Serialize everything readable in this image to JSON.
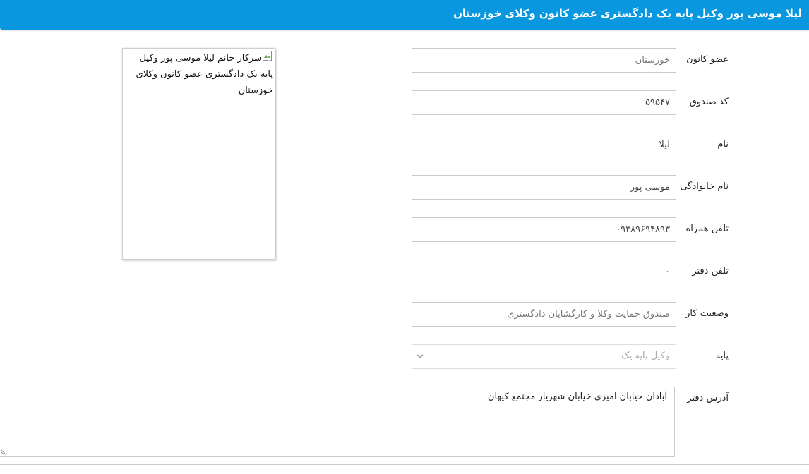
{
  "header": {
    "title": "لیلا موسی پور وکیل پایه یک دادگستری عضو کانون وکلای خوزستان",
    "background_color": "#0997e0"
  },
  "fields": [
    {
      "label": "عضو کانون",
      "value": "خوزستان"
    },
    {
      "label": "کد صندوق",
      "value": "۵۹۵۴۷"
    },
    {
      "label": "نام",
      "value": "لیلا"
    },
    {
      "label": "نام خانوادگی",
      "value": "موسی پور"
    },
    {
      "label": "تلفن همراه",
      "value": "۰۹۳۸۹۶۹۴۸۹۳"
    },
    {
      "label": "تلفن دفتر",
      "value": "۰"
    },
    {
      "label": "وضعیت کار",
      "value": "صندوق حمایت وکلا و کارگشایان دادگستری"
    }
  ],
  "grade": {
    "label": "پایه",
    "selected": "وکیل پایه یک"
  },
  "address": {
    "label": "آدرس دفتر",
    "value": "آبادان خیابان امیری خیابان شهریار مجتمع کیهان"
  },
  "photo": {
    "alt_text": "سرکار خانم لیلا موسی پور وکیل پایه یک دادگستری عضو کانون وکلای خوزستان",
    "icon": "broken-image-icon"
  }
}
